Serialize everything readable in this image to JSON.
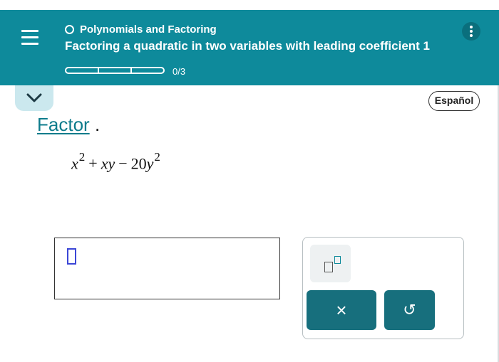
{
  "header": {
    "topic": "Polynomials and Factoring",
    "lesson": "Factoring a quadratic in two variables with leading coefficient 1",
    "progress_text": "0/3",
    "progress": {
      "completed": 0,
      "total": 3
    },
    "menu_icon": "hamburger-icon",
    "more_icon": "vertical-dots-icon",
    "accent_color": "#0e8a9b"
  },
  "language_button": "Español",
  "question": {
    "instruction_link": "Factor",
    "instruction_end": ".",
    "expression": {
      "x": "x",
      "x_exp": "2",
      "plus": "+",
      "xy": "xy",
      "minus": "−",
      "coef": "20",
      "y": "y",
      "y_exp": "2"
    }
  },
  "answer": {
    "value": ""
  },
  "tools": {
    "exponent_icon": "superscript-icon",
    "clear_label": "×",
    "undo_label": "↺"
  }
}
